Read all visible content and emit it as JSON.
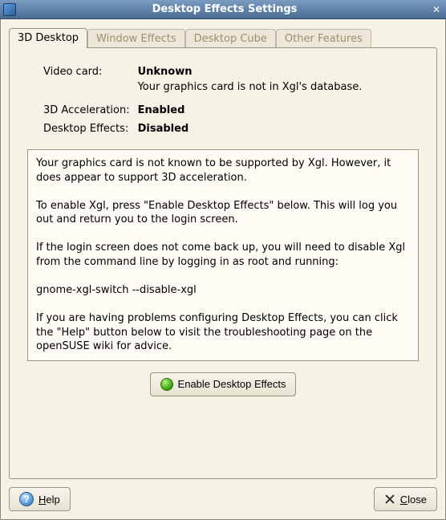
{
  "window": {
    "title": "Desktop Effects Settings"
  },
  "tabs": [
    {
      "label": "3D Desktop",
      "active": true
    },
    {
      "label": "Window Effects",
      "active": false
    },
    {
      "label": "Desktop Cube",
      "active": false
    },
    {
      "label": "Other Features",
      "active": false
    }
  ],
  "info": {
    "video_card_label": "Video card:",
    "video_card_value": "Unknown",
    "video_card_note": "Your graphics card is not in Xgl's database.",
    "accel_label": "3D Acceleration:",
    "accel_value": "Enabled",
    "effects_label": "Desktop Effects:",
    "effects_value": "Disabled"
  },
  "message": "Your graphics card is not known to be supported by Xgl. However, it does appear to support 3D acceleration.\n\nTo enable Xgl, press \"Enable Desktop Effects\" below. This will log you out and return you to the login screen.\n\nIf the login screen does not come back up, you will need to disable Xgl from the command line by logging in as root and running:\n\ngnome-xgl-switch --disable-xgl\n\nIf you are having problems configuring Desktop Effects, you can click the \"Help\" button below to visit the troubleshooting page on the openSUSE wiki for advice.",
  "buttons": {
    "enable": "Enable Desktop Effects",
    "help": "Help",
    "close": "Close"
  }
}
